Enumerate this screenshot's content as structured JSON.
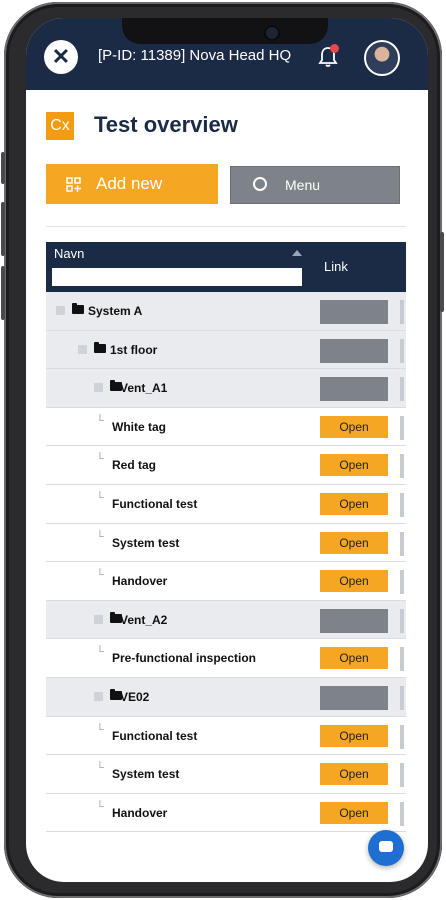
{
  "app": {
    "project_title": "[P-ID: 11389] Nova Head HQ",
    "logo_glyph": "✕"
  },
  "page": {
    "badge_text": "Cx",
    "title": "Test overview"
  },
  "toolbar": {
    "add_label": "Add new",
    "menu_label": "Menu"
  },
  "table": {
    "col_name": "Navn",
    "col_link": "Link",
    "filter_value": "",
    "open_label": "Open",
    "rows": [
      {
        "name": "System A",
        "level": 0,
        "kind": "group"
      },
      {
        "name": "1st floor",
        "level": 1,
        "kind": "group"
      },
      {
        "name": "Vent_A1",
        "level": 2,
        "kind": "group"
      },
      {
        "name": "White tag",
        "level": 3,
        "kind": "item"
      },
      {
        "name": "Red tag",
        "level": 3,
        "kind": "item"
      },
      {
        "name": "Functional test",
        "level": 3,
        "kind": "item"
      },
      {
        "name": "System test",
        "level": 3,
        "kind": "item"
      },
      {
        "name": "Handover",
        "level": 3,
        "kind": "item"
      },
      {
        "name": "Vent_A2",
        "level": 2,
        "kind": "group"
      },
      {
        "name": "Pre-functional inspection",
        "level": 3,
        "kind": "item"
      },
      {
        "name": "VE02",
        "level": 2,
        "kind": "group"
      },
      {
        "name": "Functional test",
        "level": 3,
        "kind": "item"
      },
      {
        "name": "System test",
        "level": 3,
        "kind": "item"
      },
      {
        "name": "Handover",
        "level": 3,
        "kind": "item"
      }
    ]
  },
  "colors": {
    "navy": "#1b2a45",
    "orange": "#f5a623",
    "gray": "#7d8388",
    "group_row": "#e9ebef"
  },
  "icons": {
    "logo": "x-logo-icon",
    "bell": "bell-icon",
    "add": "add-grid-icon",
    "menu": "circle-icon",
    "folder": "folder-icon",
    "chat": "chat-icon"
  }
}
